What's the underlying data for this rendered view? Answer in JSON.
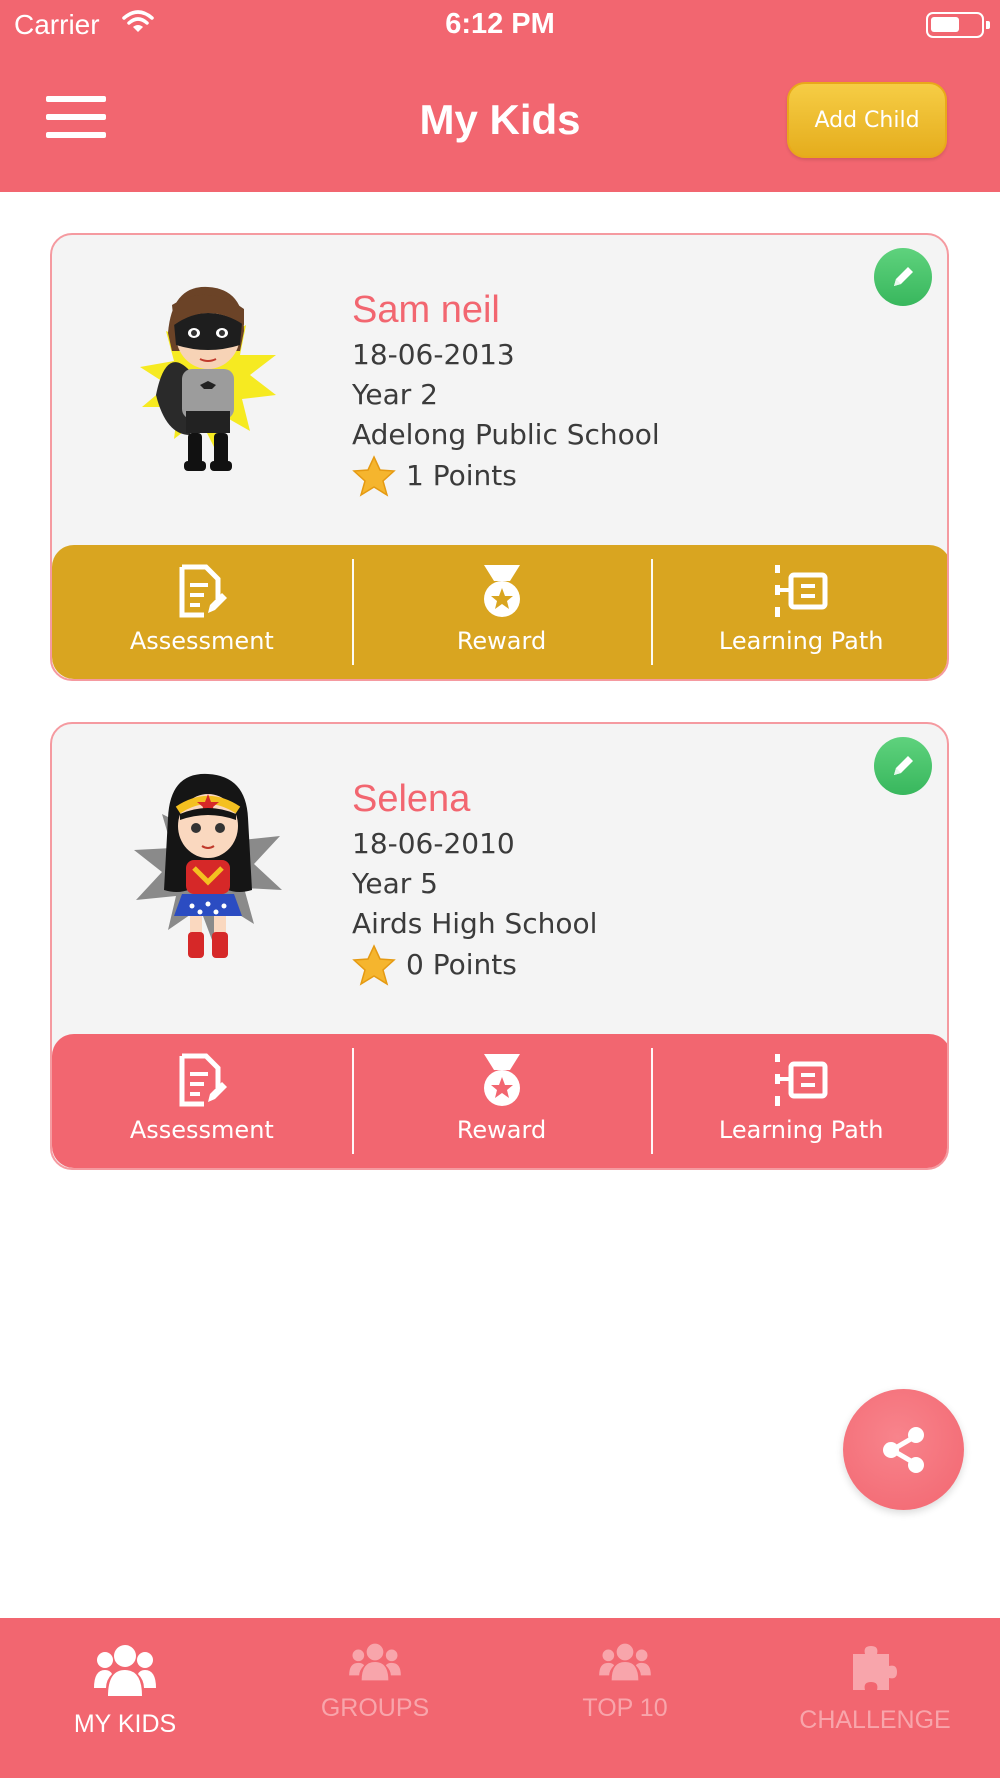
{
  "status_bar": {
    "carrier": "Carrier",
    "time": "6:12 PM"
  },
  "header": {
    "title": "My Kids",
    "add_child_label": "Add Child"
  },
  "kids": [
    {
      "name": "Sam neil",
      "dob": "18-06-2013",
      "year": "Year 2",
      "school": "Adelong Public School",
      "points": "1 Points",
      "actions": [
        "Assessment",
        "Reward",
        "Learning Path"
      ],
      "accent_color": "#d9a520"
    },
    {
      "name": "Selena",
      "dob": "18-06-2010",
      "year": "Year 5",
      "school": "Airds High School",
      "points": "0 Points",
      "actions": [
        "Assessment",
        "Reward",
        "Learning Path"
      ],
      "accent_color": "#f26670"
    }
  ],
  "tabs": [
    {
      "label": "MY KIDS",
      "icon": "group-icon",
      "active": true
    },
    {
      "label": "GROUPS",
      "icon": "group-icon",
      "active": false
    },
    {
      "label": "TOP 10",
      "icon": "group-icon",
      "active": false
    },
    {
      "label": "CHALLENGE",
      "icon": "puzzle-icon",
      "active": false
    }
  ],
  "colors": {
    "primary": "#f26670",
    "gold": "#d9a520",
    "edit_green": "#4cc46c"
  }
}
